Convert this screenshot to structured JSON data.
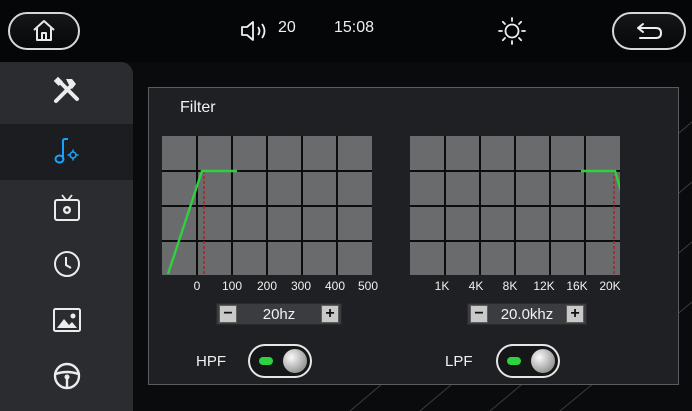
{
  "status_bar": {
    "volume_level": "20",
    "time": "15:08",
    "icons": [
      "home-icon",
      "speaker-icon",
      "brightness-icon",
      "back-icon"
    ]
  },
  "sidebar": {
    "items": [
      {
        "icon": "tools-icon",
        "active": false
      },
      {
        "icon": "audio-settings-icon",
        "active": true
      },
      {
        "icon": "tv-settings-icon",
        "active": false
      },
      {
        "icon": "clock-icon",
        "active": false
      },
      {
        "icon": "image-icon",
        "active": false
      },
      {
        "icon": "steering-wheel-icon",
        "active": false
      }
    ]
  },
  "filter": {
    "title": "Filter",
    "hpf": {
      "ticks": [
        "0",
        "100",
        "200",
        "300",
        "400",
        "500"
      ],
      "value": "20hz",
      "label": "HPF",
      "enabled": true
    },
    "lpf": {
      "ticks": [
        "1K",
        "4K",
        "8K",
        "12K",
        "16K",
        "20K"
      ],
      "value": "20.0khz",
      "label": "LPF",
      "enabled": true
    }
  },
  "colors": {
    "curve": "#2ed13f",
    "cutoff_marker": "#b22222",
    "graph_bg": "#6a6b6d",
    "toggle_on": "#2ed13f"
  }
}
